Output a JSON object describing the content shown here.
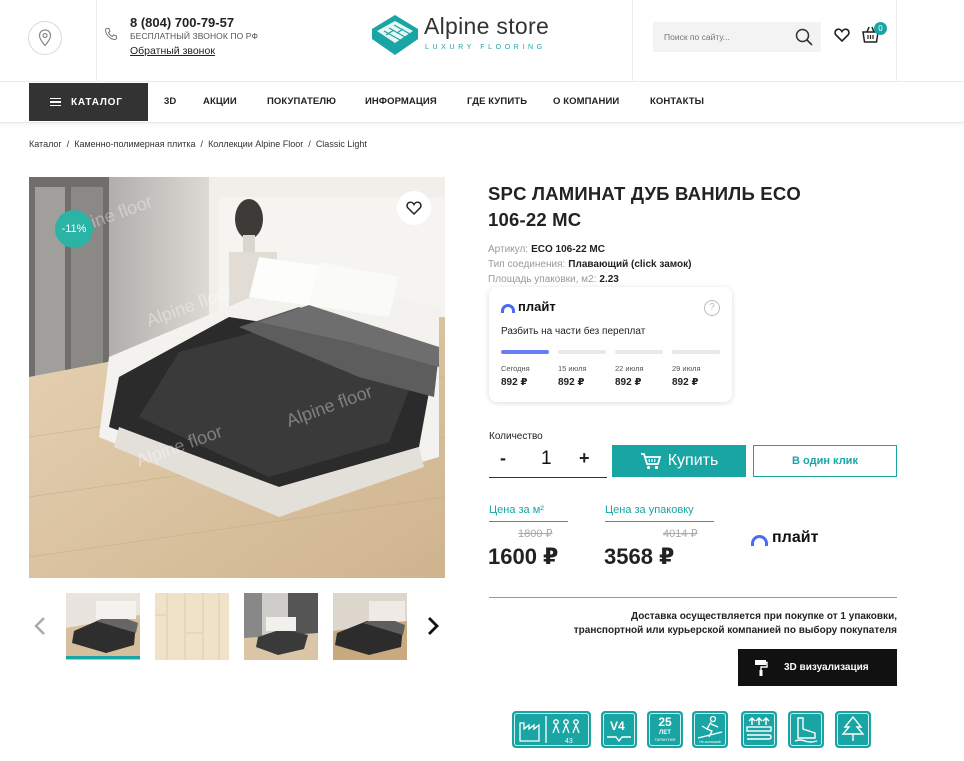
{
  "header": {
    "phone": "8 (804) 700-79-57",
    "phone_sub": "БЕСПЛАТНЫЙ ЗВОНОК ПО РФ",
    "callback": "Обратный звонок",
    "logo_title": "Alpine store",
    "logo_sub": "LUXURY FLOORING",
    "search_placeholder": "Поиск по сайту...",
    "cart_count": "0"
  },
  "nav": {
    "catalog": "КАТАЛОГ",
    "items": [
      "3D",
      "АКЦИИ",
      "ПОКУПАТЕЛЮ",
      "ИНФОРМАЦИЯ",
      "ГДЕ КУПИТЬ",
      "О КОМПАНИИ",
      "КОНТАКТЫ"
    ]
  },
  "breadcrumb": [
    "Каталог",
    "Каменно-полимерная плитка",
    "Коллекции Alpine Floor",
    "Classic Light"
  ],
  "gallery": {
    "discount": "-11%",
    "watermark": "Alpine floor"
  },
  "product": {
    "title_line1": "SPC ЛАМИНАТ ДУБ ВАНИЛЬ ECO",
    "title_line2": "106-22 MC",
    "specs": [
      {
        "label": "Артикул:",
        "value": "ECO 106-22 MC"
      },
      {
        "label": "Тип соединения:",
        "value": "Плавающий (click замок)"
      },
      {
        "label": "Площадь упаковки, м2:",
        "value": "2.23"
      }
    ]
  },
  "plait": {
    "brand": "плайт",
    "help": "?",
    "description": "Разбить на части без переплат",
    "payments": [
      {
        "date": "Сегодня",
        "amount": "892 ₽"
      },
      {
        "date": "15 июля",
        "amount": "892 ₽"
      },
      {
        "date": "22 июля",
        "amount": "892 ₽"
      },
      {
        "date": "29 июля",
        "amount": "892 ₽"
      }
    ],
    "paid_parts": 1
  },
  "purchase": {
    "qty_label": "Количество",
    "qty_minus": "-",
    "qty_value": "1",
    "qty_plus": "+",
    "buy_label": "Купить",
    "one_click": "В один клик"
  },
  "prices": {
    "per_m2_label": "Цена за м²",
    "per_m2_old": "1800 ₽",
    "per_m2_new": "1600 ₽",
    "per_pack_label": "Цена за упаковку",
    "per_pack_old": "4014 ₽",
    "per_pack_new": "3568 ₽",
    "plait_brand": "плайт"
  },
  "delivery": {
    "line1": "Доставка осуществляется при покупке от 1 упаковки,",
    "line2": "транспортной или курьерской компанией по выбору покупателя"
  },
  "viz_button": "3D визуализация",
  "features": {
    "class_label": "43",
    "v4_label": "V4",
    "years": "25",
    "years_sub": "ЛЕТ",
    "warranty_sub": "ГАРАНТИЯ",
    "slip_sub": "Не скользкий"
  },
  "colors": {
    "accent": "#1aa5a5",
    "dark": "#333333",
    "plait_blue": "#4b6bf5"
  }
}
